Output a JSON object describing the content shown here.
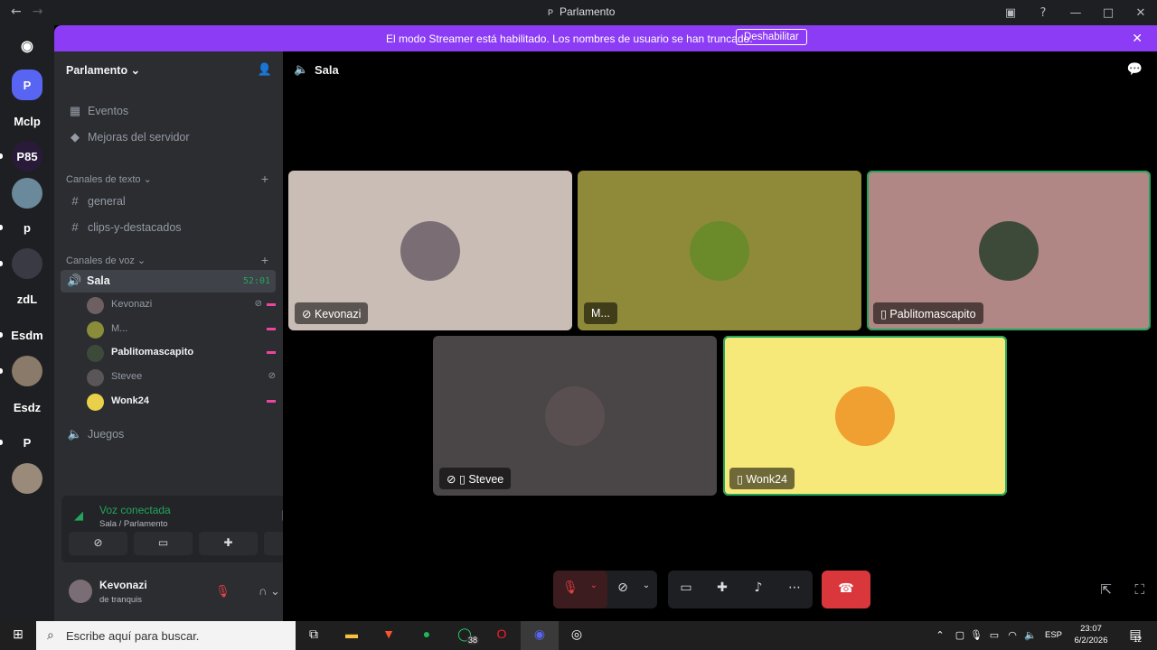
{
  "window": {
    "title": "Parlamento",
    "title_icon": "P"
  },
  "banner": {
    "text": "El modo Streamer está habilitado. Los nombres de usuario se han truncado.",
    "button": "Deshabilitar"
  },
  "guilds": [
    {
      "label": "P",
      "color": "#5865f2",
      "badge": "0"
    },
    {
      "label": "Mclp",
      "color": "#1e1f22"
    },
    {
      "label": "P85",
      "color": "#2a1a3a"
    },
    {
      "label": "",
      "color": "#6a8a9c"
    },
    {
      "label": "p",
      "color": "#1e1f22"
    },
    {
      "label": "",
      "color": "#3a3a44"
    },
    {
      "label": "zdL",
      "color": "#1e1f22"
    },
    {
      "label": "Esdm",
      "color": "#1e1f22"
    },
    {
      "label": "",
      "color": "#8a7a6a"
    },
    {
      "label": "Esdz",
      "color": "#1e1f22"
    },
    {
      "label": "P",
      "color": "#1e1f22"
    },
    {
      "label": "",
      "color": "#9a8a7a"
    }
  ],
  "sidebar": {
    "server": "Parlamento",
    "events": "Eventos",
    "boosts": "Mejoras del servidor",
    "text_category": "Canales de texto",
    "text_channels": [
      "general",
      "clips-y-destacados"
    ],
    "voice_category": "Canales de voz",
    "active_channel": {
      "name": "Sala",
      "time": "52:01"
    },
    "voice_users": [
      {
        "name": "Kevonazi",
        "bold": false,
        "muted": true,
        "streamer": true,
        "color": "#6e5f63"
      },
      {
        "name": "M...",
        "bold": false,
        "muted": false,
        "streamer": true,
        "color": "#8a8c3a"
      },
      {
        "name": "Pablitomascapito",
        "bold": true,
        "muted": false,
        "streamer": true,
        "color": "#3d4a3a"
      },
      {
        "name": "Stevee",
        "bold": false,
        "muted": true,
        "streamer": false,
        "color": "#5a5556"
      },
      {
        "name": "Wonk24",
        "bold": true,
        "muted": false,
        "streamer": true,
        "color": "#e8d04a"
      }
    ],
    "other_voice": "Juegos"
  },
  "voice_panel": {
    "status": "Voz conectada",
    "location": "Sala / Parlamento"
  },
  "user": {
    "name": "Kevonazi",
    "status": "de tranquis"
  },
  "main": {
    "channel": "Sala"
  },
  "tiles": [
    {
      "name": "Kevonazi",
      "bg": "#c9bdb6",
      "avatar": "#7a6e74",
      "speaking": false,
      "icons": "muted"
    },
    {
      "name": "M...",
      "bg": "#8e8a3a",
      "avatar": "#6b8a2a",
      "speaking": false,
      "icons": ""
    },
    {
      "name": "Pablitomascapito",
      "bg": "#b08784",
      "avatar": "#3d4a3a",
      "speaking": true,
      "icons": "phone"
    },
    {
      "name": "Stevee",
      "bg": "#4a4647",
      "avatar": "#5a4f50",
      "speaking": false,
      "icons": "muted-phone"
    },
    {
      "name": "Wonk24",
      "bg": "#f6e97a",
      "avatar": "#f0a030",
      "speaking": true,
      "icons": "phone"
    }
  ],
  "taskbar": {
    "search_placeholder": "Escribe aquí para buscar.",
    "whatsapp_badge": "38",
    "lang": "ESP",
    "time": "23:07",
    "date": "6/2/2026",
    "notif": "12"
  }
}
